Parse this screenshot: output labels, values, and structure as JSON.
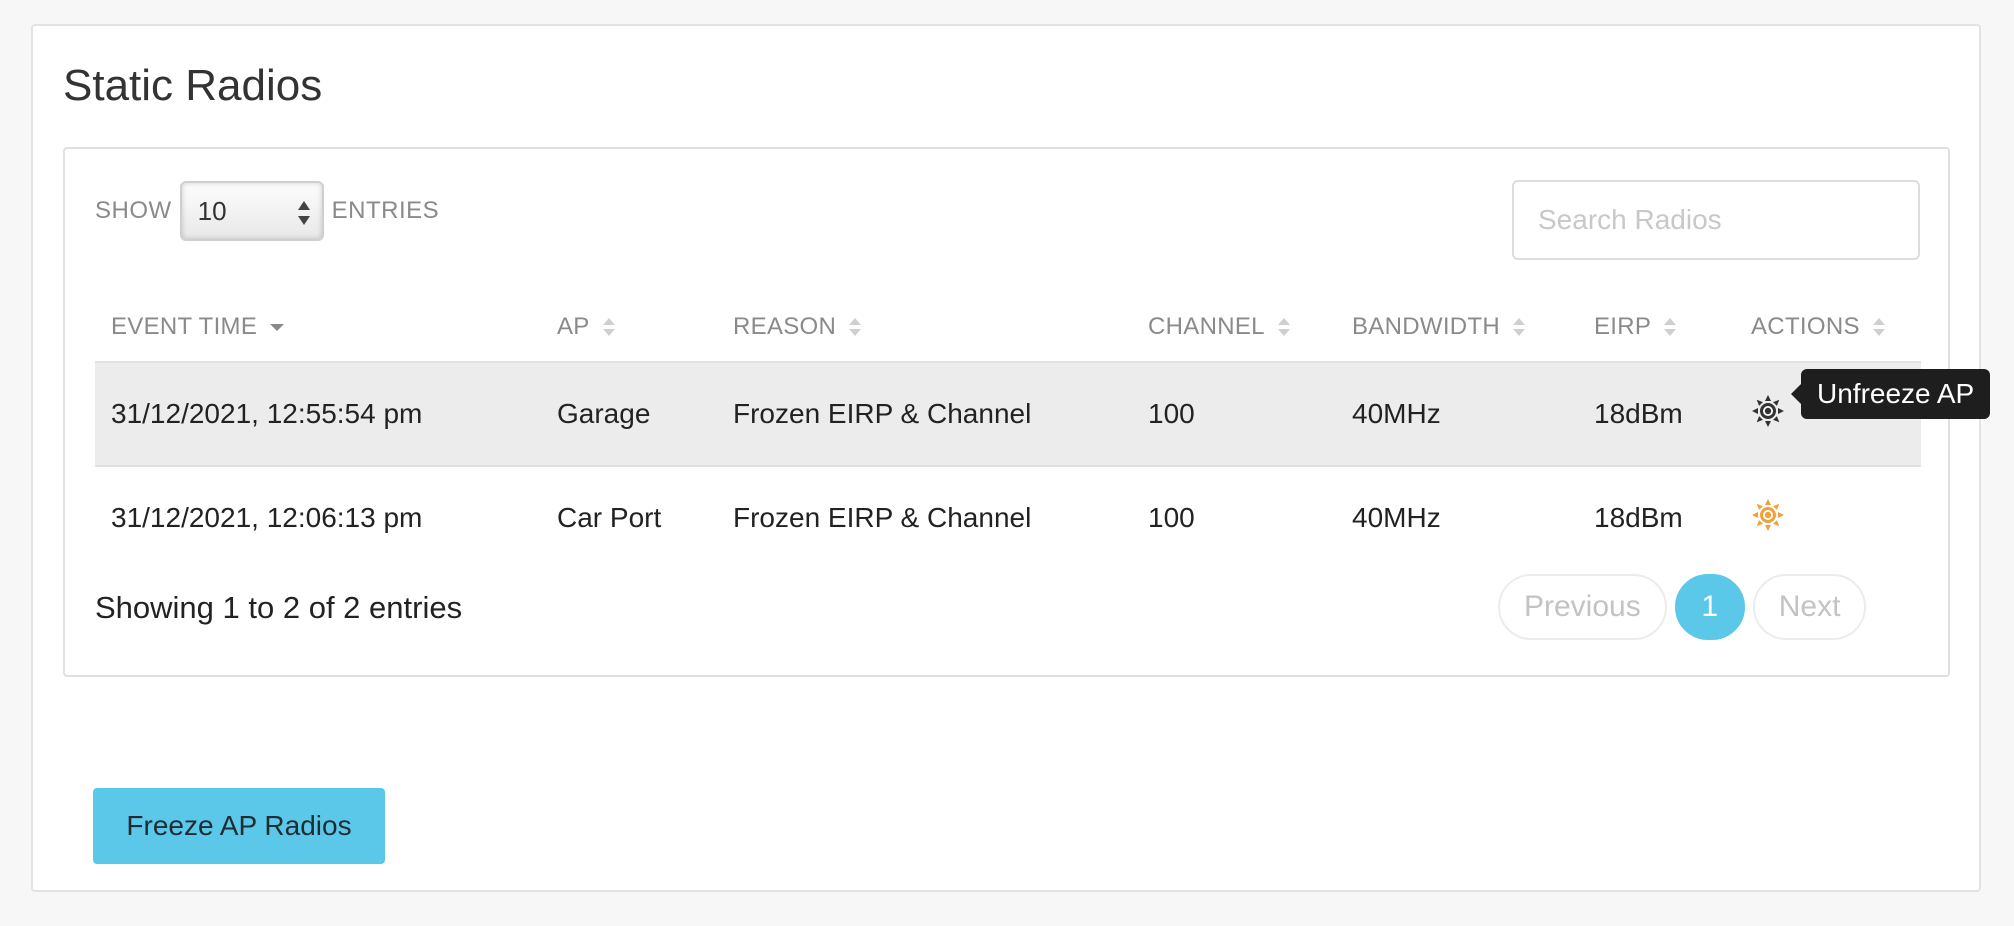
{
  "panel": {
    "title": "Static Radios"
  },
  "controls": {
    "show_label": "SHOW",
    "page_size": "10",
    "entries_label": "ENTRIES",
    "search_placeholder": "Search Radios"
  },
  "table": {
    "columns": [
      "EVENT TIME",
      "AP",
      "REASON",
      "CHANNEL",
      "BANDWIDTH",
      "EIRP",
      "ACTIONS"
    ],
    "sorted_column": "EVENT TIME",
    "sort_direction": "descending",
    "rows": [
      {
        "event_time": "31/12/2021, 12:55:54 pm",
        "ap": "Garage",
        "reason": "Frozen EIRP & Channel",
        "channel": "100",
        "bandwidth": "40MHz",
        "eirp": "18dBm",
        "action_icon": "sun-icon",
        "action_color": "#333333"
      },
      {
        "event_time": "31/12/2021, 12:06:13 pm",
        "ap": "Car Port",
        "reason": "Frozen EIRP & Channel",
        "channel": "100",
        "bandwidth": "40MHz",
        "eirp": "18dBm",
        "action_icon": "sun-icon",
        "action_color": "#f0a23a"
      }
    ]
  },
  "tooltip": {
    "text": "Unfreeze AP"
  },
  "footer": {
    "summary": "Showing 1 to 2 of 2 entries",
    "previous": "Previous",
    "current_page": "1",
    "next": "Next"
  },
  "actions": {
    "freeze_label": "Freeze AP Radios"
  },
  "colors": {
    "accent": "#5bc8ea",
    "hover_row": "#ececec",
    "action_active": "#f0a23a"
  }
}
